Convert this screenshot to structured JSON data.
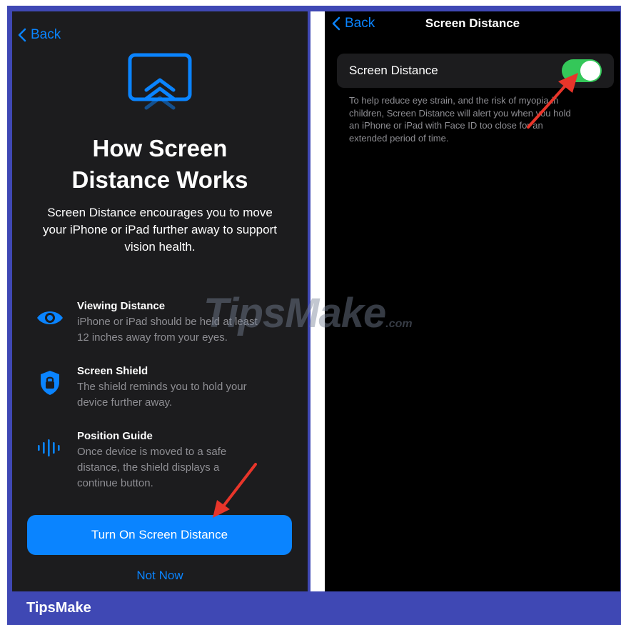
{
  "left_screen": {
    "back_label": "Back",
    "title_lines": [
      "How Screen",
      "Distance Works"
    ],
    "intro_lines": [
      "Screen Distance encourages you to move",
      "your iPhone or iPad further away to support",
      "vision health."
    ],
    "features": [
      {
        "icon": "eye-icon",
        "heading": "Viewing Distance",
        "lines": [
          "iPhone or iPad should be held at least",
          "12 inches away from your eyes."
        ]
      },
      {
        "icon": "shield-lock-icon",
        "heading": "Screen Shield",
        "lines": [
          "The shield reminds you to hold your",
          "device further away."
        ]
      },
      {
        "icon": "position-guide-icon",
        "heading": "Position Guide",
        "lines": [
          "Once device is moved to a safe",
          "distance, the shield displays a",
          "continue button."
        ]
      }
    ],
    "primary_button": "Turn On Screen Distance",
    "secondary_button": "Not Now"
  },
  "right_screen": {
    "back_label": "Back",
    "nav_title": "Screen Distance",
    "setting_label": "Screen Distance",
    "toggle_on": true,
    "footer_lines": [
      "To help reduce eye strain, and the risk of myopia in",
      "children, Screen Distance will alert you when you hold",
      "an iPhone or iPad with Face ID too close for an",
      "extended period of time."
    ]
  },
  "watermark": {
    "main": "TipsMake",
    "suffix": ".com"
  },
  "brand_footer": "TipsMake",
  "colors": {
    "accent_blue": "#0a84ff",
    "toggle_green": "#34c759",
    "arrow_red": "#e8352a",
    "frame_blue": "#3f48b4"
  }
}
